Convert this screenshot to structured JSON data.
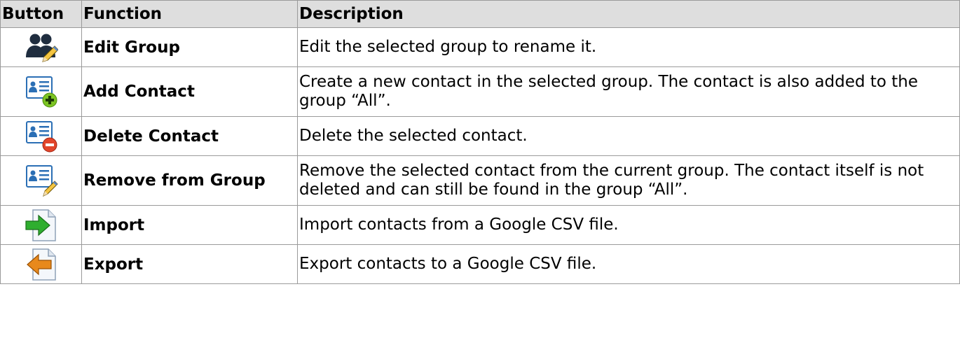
{
  "table": {
    "headers": [
      "Button",
      "Function",
      "Description"
    ],
    "rows": [
      {
        "icon": "edit-group-icon",
        "function": "Edit Group",
        "description": "Edit the selected group to rename it."
      },
      {
        "icon": "add-contact-icon",
        "function": "Add Contact",
        "description": "Create a new contact in the selected group. The contact is also added to the group “All”."
      },
      {
        "icon": "delete-contact-icon",
        "function": "Delete Contact",
        "description": "Delete the selected contact."
      },
      {
        "icon": "remove-from-group-icon",
        "function": "Remove from Group",
        "description": "Remove the selected contact from the current group. The contact itself is not deleted and can still be found in the group “All”."
      },
      {
        "icon": "import-icon",
        "function": "Import",
        "description": "Import contacts from a Google CSV file."
      },
      {
        "icon": "export-icon",
        "function": "Export",
        "description": "Export contacts to a Google CSV file."
      }
    ]
  },
  "colors": {
    "header_bg": "#dedede",
    "border": "#9a9a9a",
    "contact_card_blue": "#2b6fb5",
    "add_green": "#7cc423",
    "delete_red": "#e2452b",
    "import_green": "#2fae2f",
    "export_orange": "#e8891c"
  }
}
